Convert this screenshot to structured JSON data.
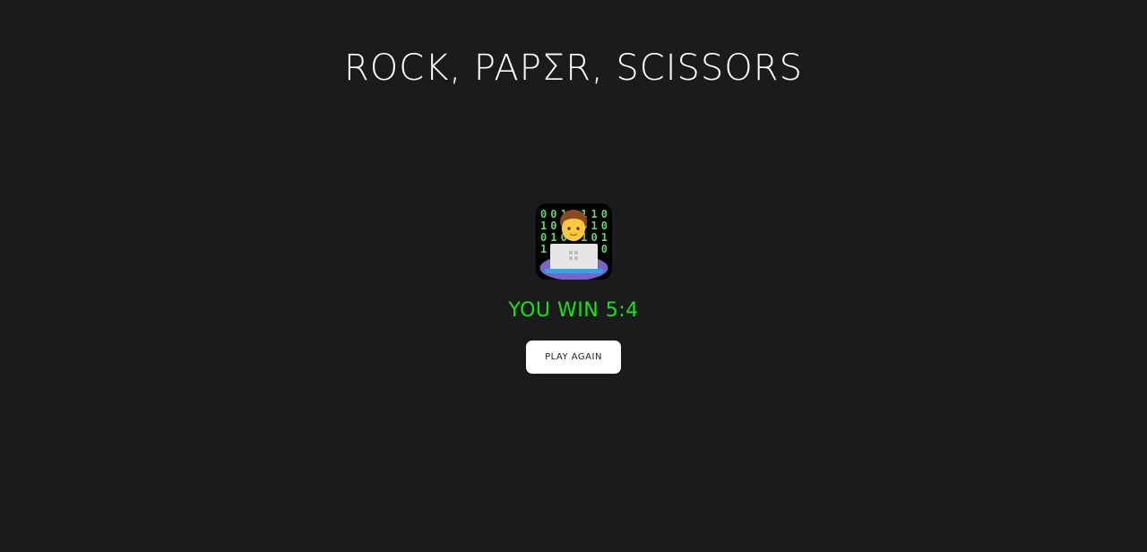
{
  "game": {
    "title": "ROCK, PAPΣR, SCISSORS",
    "result_text": "YOU WIN 5:4",
    "result_color": "#15e60f",
    "play_again_label": "PLAY AGAIN",
    "avatar_icon": "technologist-icon",
    "binary_rows": [
      "0010110",
      "1011010",
      "0101101",
      "1011010"
    ]
  }
}
